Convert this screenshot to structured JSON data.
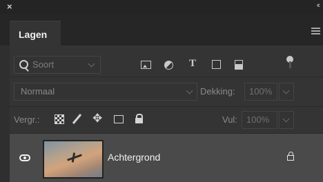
{
  "window": {
    "close_glyph": "×",
    "collapse_glyph": "‹‹"
  },
  "tabs": [
    {
      "label": "Lagen"
    }
  ],
  "filter": {
    "kind_label": "Soort",
    "icons": [
      "pixel-filter-icon",
      "adjustment-filter-icon",
      "type-filter-icon",
      "shape-filter-icon",
      "smart-object-filter-icon"
    ],
    "type_glyph": "T"
  },
  "blend": {
    "mode": "Normaal",
    "opacity_label": "Dekking:",
    "opacity_value": "100%"
  },
  "lock": {
    "label": "Vergr.:",
    "move_glyph": "✥",
    "fill_label": "Vul:",
    "fill_value": "100%"
  },
  "layers": [
    {
      "name": "Achtergrond",
      "visible": true,
      "locked": true
    }
  ],
  "colors": {
    "panel_bg": "#343434",
    "selected_layer_bg": "#4a4a4a",
    "text": "#f2f2f2"
  }
}
